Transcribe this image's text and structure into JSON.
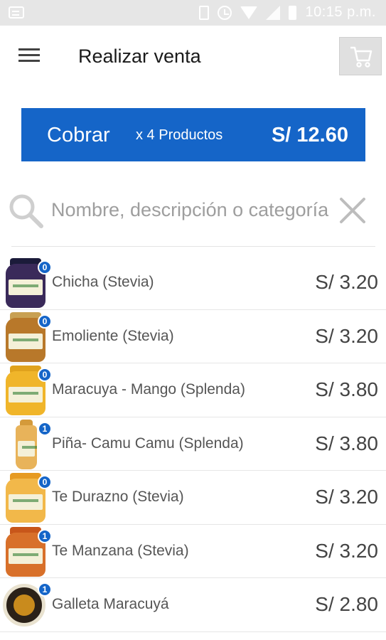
{
  "status_bar": {
    "time": "10:15 p.m.",
    "icons": [
      "message-icon",
      "vibrate-icon",
      "alarm-icon",
      "wifi-icon",
      "signal-icon",
      "battery-icon"
    ]
  },
  "app_bar": {
    "title": "Realizar venta",
    "menu_icon": "menu-icon",
    "cart_icon": "cart-icon"
  },
  "charge_button": {
    "label": "Cobrar",
    "count_text": "x 4 Productos",
    "total": "S/ 12.60",
    "color": "#1565c8"
  },
  "search": {
    "placeholder": "Nombre, descripción o categoría",
    "value": ""
  },
  "products": [
    {
      "name": "Chicha (Stevia)",
      "price": "S/ 3.20",
      "qty": "0"
    },
    {
      "name": "Emoliente (Stevia)",
      "price": "S/ 3.20",
      "qty": "0"
    },
    {
      "name": "Maracuya - Mango (Splenda)",
      "price": "S/ 3.80",
      "qty": "0"
    },
    {
      "name": "Piña- Camu Camu (Splenda)",
      "price": "S/ 3.80",
      "qty": "1"
    },
    {
      "name": "Te Durazno (Stevia)",
      "price": "S/ 3.20",
      "qty": "0"
    },
    {
      "name": "Te Manzana (Stevia)",
      "price": "S/ 3.20",
      "qty": "1"
    },
    {
      "name": "Galleta Maracuyá",
      "price": "S/ 2.80",
      "qty": "1"
    }
  ]
}
